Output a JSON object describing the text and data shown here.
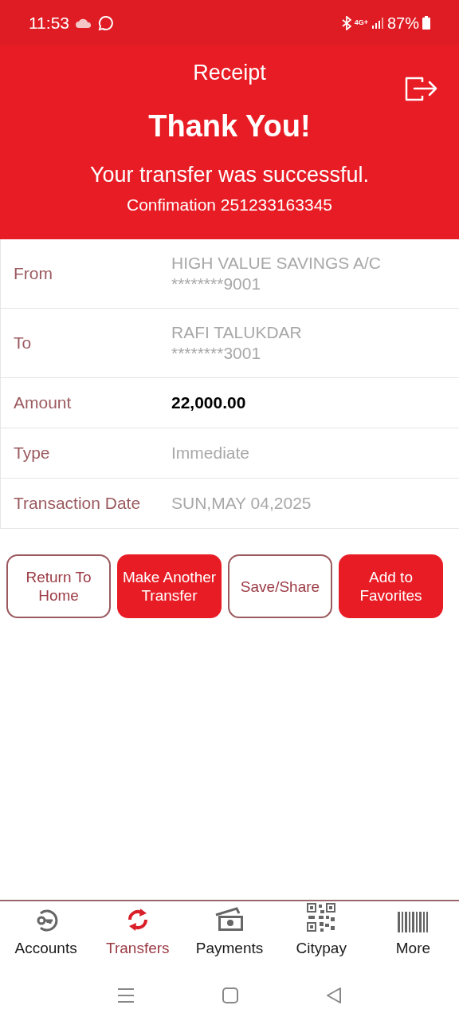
{
  "status_bar": {
    "time": "11:53",
    "network": "4G+",
    "battery": "87%"
  },
  "header": {
    "title": "Receipt",
    "heading": "Thank You!",
    "message": "Your transfer was successful.",
    "confirmation": "Confimation 251233163345"
  },
  "details": [
    {
      "label": "From",
      "kind": "plain",
      "lines": [
        "HIGH VALUE SAVINGS A/C",
        "********9001"
      ]
    },
    {
      "label": "To",
      "kind": "plain",
      "lines": [
        "RAFI TALUKDAR",
        "********3001"
      ]
    },
    {
      "label": "Amount",
      "kind": "emphasis",
      "lines": [
        "22,000.00"
      ]
    },
    {
      "label": "Type",
      "kind": "plain",
      "lines": [
        "Immediate"
      ]
    },
    {
      "label": "Transaction Date",
      "kind": "plain",
      "lines": [
        "SUN,MAY 04,2025"
      ]
    }
  ],
  "buttons": [
    {
      "label": "Return To Home",
      "kind": "outline"
    },
    {
      "label": "Make Another Transfer",
      "kind": "filled"
    },
    {
      "label": "Save/Share",
      "kind": "outline"
    },
    {
      "label": "Add to Favorites",
      "kind": "filled"
    }
  ],
  "bottom_nav": [
    {
      "label": "Accounts",
      "selected": false
    },
    {
      "label": "Transfers",
      "selected": true
    },
    {
      "label": "Payments",
      "selected": false
    },
    {
      "label": "Citypay",
      "selected": false
    },
    {
      "label": "More",
      "selected": false
    }
  ]
}
